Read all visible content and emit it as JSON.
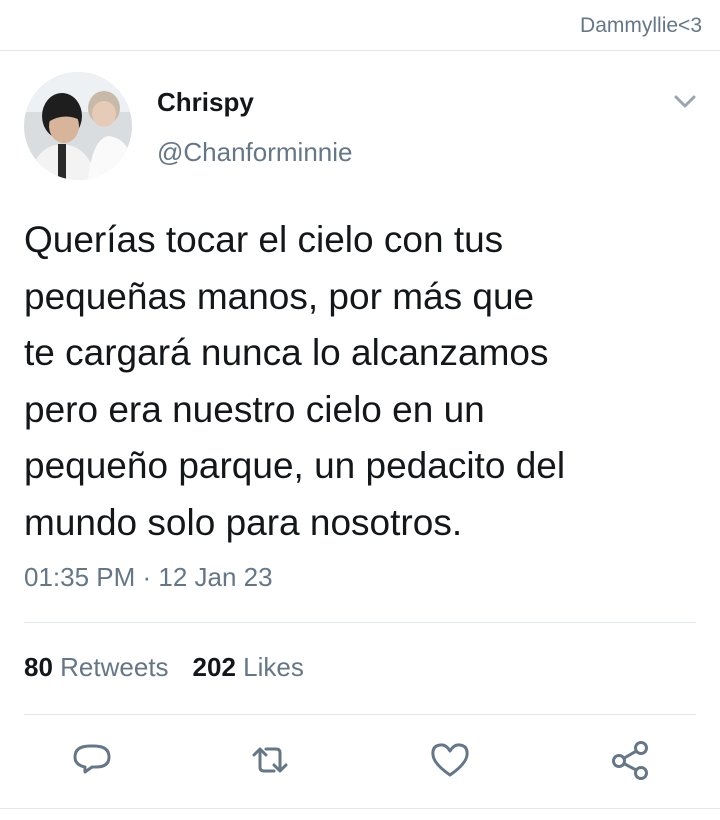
{
  "watermark": "Dammyllie<3",
  "author": {
    "display_name": "Chrispy",
    "handle": "@Chanforminnie"
  },
  "tweet": {
    "text": "Querías tocar el cielo con tus\npequeñas manos, por más que\nte cargará nunca lo alcanzamos\npero era nuestro cielo en un\npequeño parque, un pedacito del\nmundo solo para nosotros.",
    "timestamp": "01:35 PM · 12 Jan 23"
  },
  "stats": {
    "retweets_count": "80",
    "retweets_label": "Retweets",
    "likes_count": "202",
    "likes_label": "Likes"
  },
  "icons": {
    "menu": "chevron-down-icon",
    "reply": "reply-icon",
    "retweet": "retweet-icon",
    "like": "heart-icon",
    "share": "share-icon"
  },
  "colors": {
    "text_primary": "#14171a",
    "text_secondary": "#657786",
    "divider": "#e1e8ed",
    "icon": "#657786"
  }
}
